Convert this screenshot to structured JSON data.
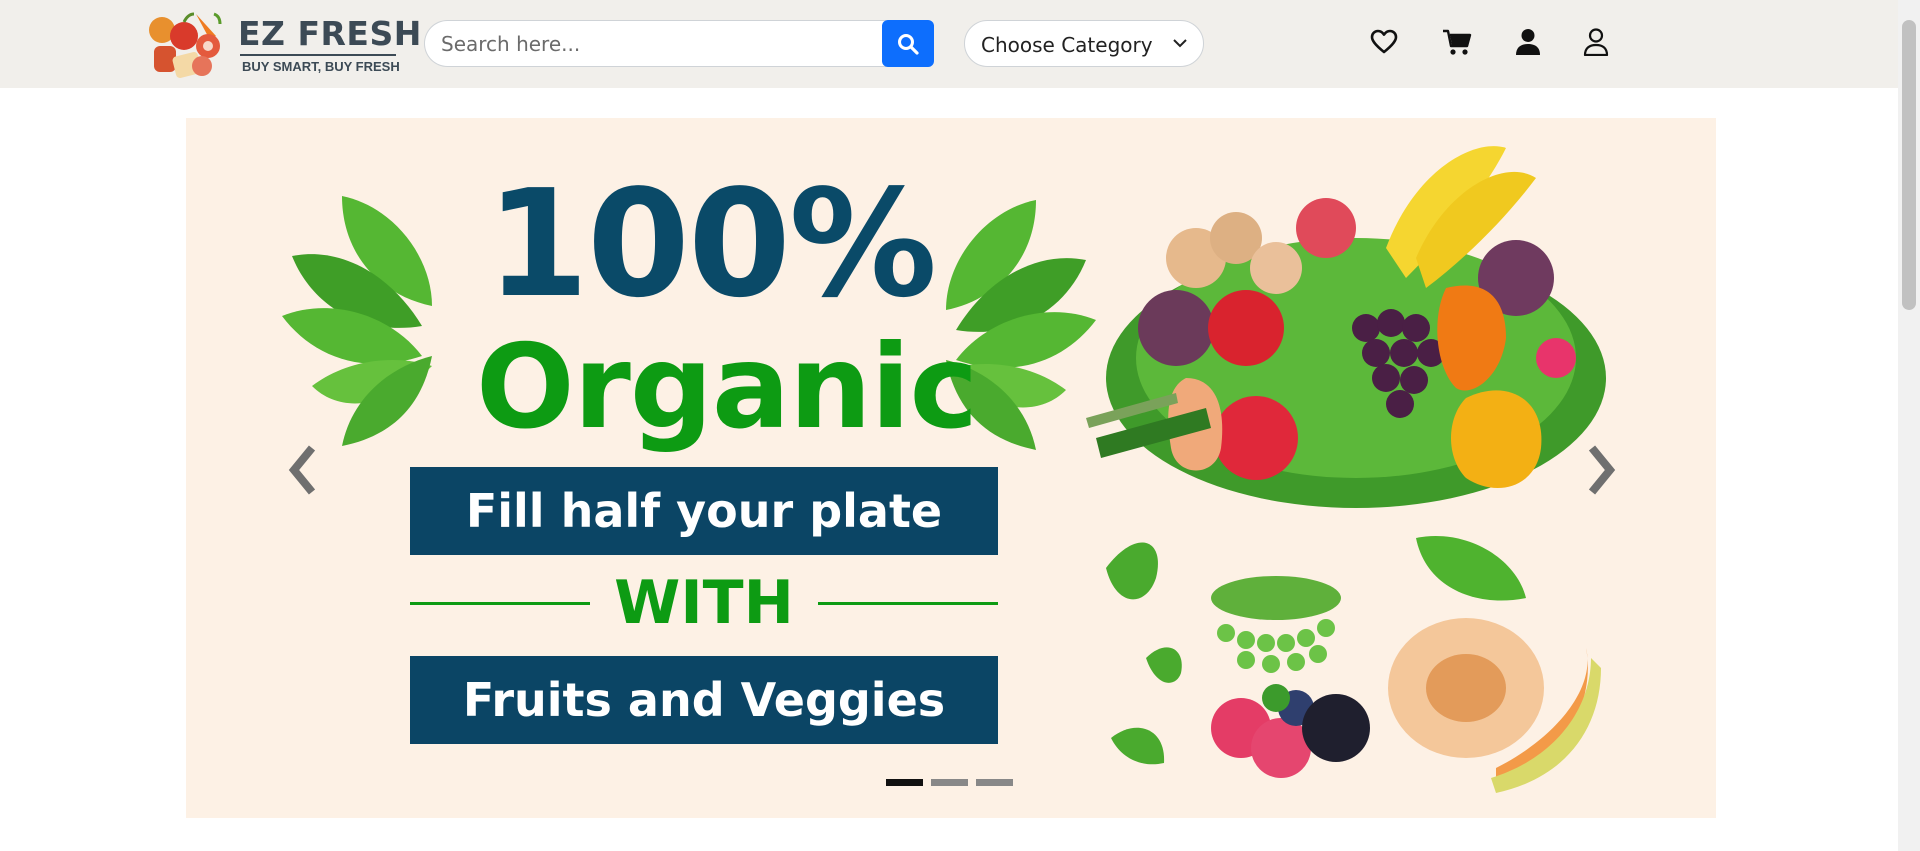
{
  "header": {
    "logo": {
      "title": "EZ FRESH",
      "tagline": "BUY SMART, BUY FRESH"
    },
    "search": {
      "placeholder": "Search here...",
      "value": ""
    },
    "category": {
      "selected": "Choose Category"
    },
    "icons": [
      "heart-icon",
      "cart-icon",
      "user-filled-icon",
      "user-outline-icon"
    ]
  },
  "hero": {
    "headline": "100%",
    "subheadline": "Organic",
    "band_top": "Fill half your plate",
    "connector": "WITH",
    "band_bottom": "Fruits and Veggies",
    "slide_count": 3,
    "active_slide": 1
  },
  "colors": {
    "header_bg": "#f1efeb",
    "accent_blue": "#0d6efd",
    "navy": "#0b4565",
    "green": "#0d9b13",
    "hero_bg": "#fdf1e5"
  }
}
